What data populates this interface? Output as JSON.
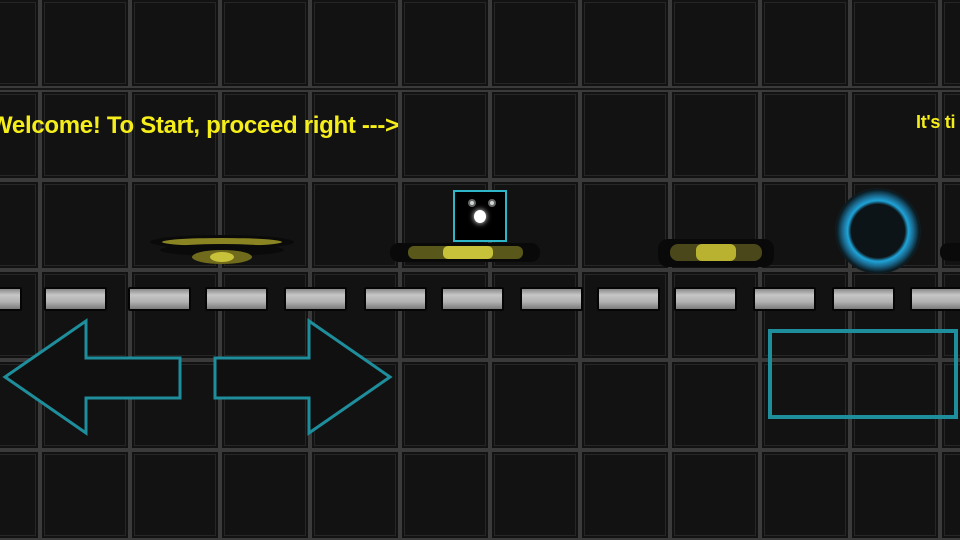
{
  "messages": {
    "welcome": "Welcome! To Start, proceed right --->",
    "offscreen": "It's ti"
  },
  "colors": {
    "background": "#161616",
    "tile_border": "#3a3a3a",
    "message_text": "#f6ee1a",
    "accent_cyan": "#2fb5c8",
    "portal_glow": "#1fa4d8",
    "pad_yellow": "#c8c23a",
    "brick_gray": "#b0b0b0"
  },
  "controls": {
    "left": "arrow-left-icon",
    "right": "arrow-right-icon",
    "jump": "jump-button-outline"
  },
  "icons": {
    "player": "cube-face-icon",
    "portal": "glowing-ring-portal-icon"
  }
}
